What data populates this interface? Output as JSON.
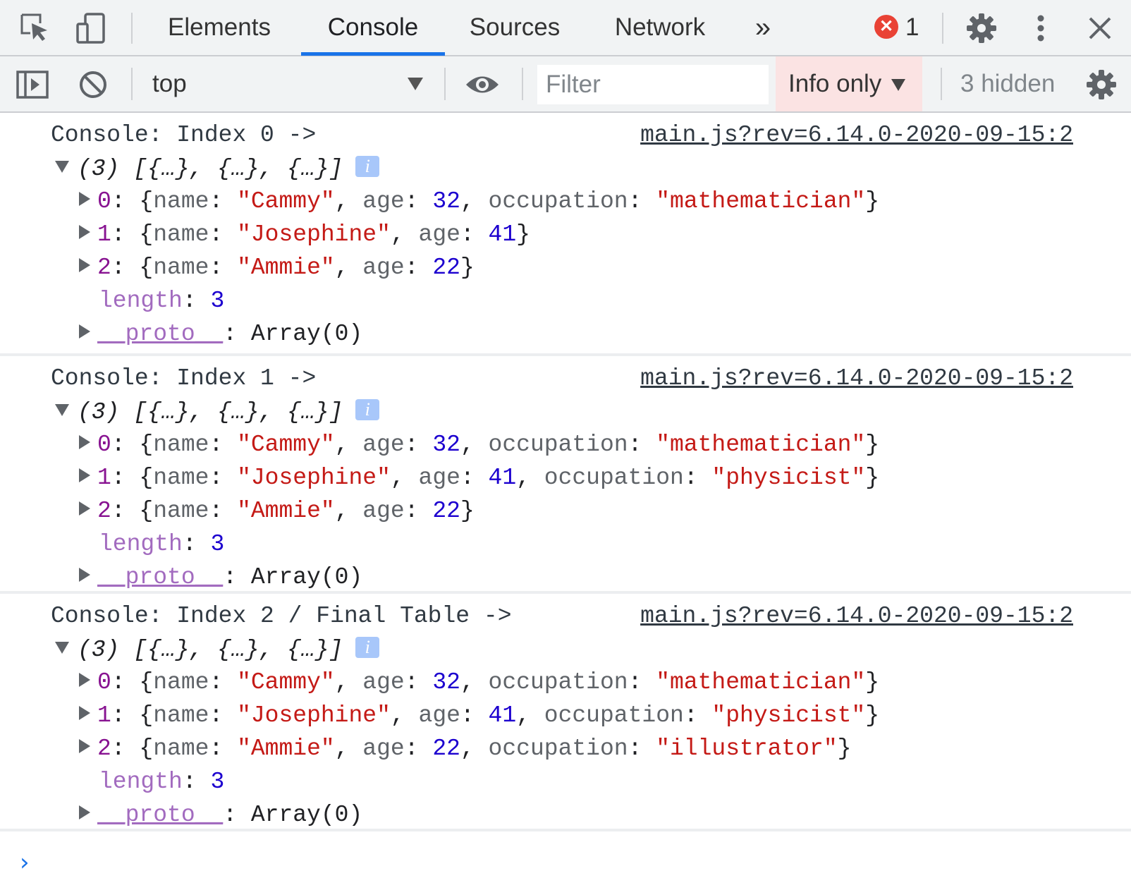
{
  "tabbar": {
    "tabs": [
      "Elements",
      "Console",
      "Sources",
      "Network"
    ],
    "overflow": "»",
    "error_count": "1",
    "error_badge": "✕"
  },
  "toolbar": {
    "context": "top",
    "filter_placeholder": "Filter",
    "levels_label": "Info only",
    "hidden_count": "3 hidden"
  },
  "messages": [
    {
      "header": "Console: Index 0 ->",
      "source": "main.js?rev=6.14.0-2020-09-15:2",
      "summary": "(3) [{…}, {…}, {…}]",
      "info_badge": "i",
      "rows": [
        {
          "index": "0",
          "name": "\"Cammy\"",
          "age": "32",
          "occupation": "\"mathematician\""
        },
        {
          "index": "1",
          "name": "\"Josephine\"",
          "age": "41",
          "occupation": ""
        },
        {
          "index": "2",
          "name": "\"Ammie\"",
          "age": "22",
          "occupation": ""
        }
      ],
      "length_key": "length",
      "length_value": "3",
      "proto_key": "__proto__",
      "proto_value": "Array(0)"
    },
    {
      "header": "Console: Index 1 ->",
      "source": "main.js?rev=6.14.0-2020-09-15:2",
      "summary": "(3) [{…}, {…}, {…}]",
      "info_badge": "i",
      "rows": [
        {
          "index": "0",
          "name": "\"Cammy\"",
          "age": "32",
          "occupation": "\"mathematician\""
        },
        {
          "index": "1",
          "name": "\"Josephine\"",
          "age": "41",
          "occupation": "\"physicist\""
        },
        {
          "index": "2",
          "name": "\"Ammie\"",
          "age": "22",
          "occupation": ""
        }
      ],
      "length_key": "length",
      "length_value": "3",
      "proto_key": "__proto__",
      "proto_value": "Array(0)"
    },
    {
      "header": "Console: Index 2 / Final Table ->",
      "source": "main.js?rev=6.14.0-2020-09-15:2",
      "summary": "(3) [{…}, {…}, {…}]",
      "info_badge": "i",
      "rows": [
        {
          "index": "0",
          "name": "\"Cammy\"",
          "age": "32",
          "occupation": "\"mathematician\""
        },
        {
          "index": "1",
          "name": "\"Josephine\"",
          "age": "41",
          "occupation": "\"physicist\""
        },
        {
          "index": "2",
          "name": "\"Ammie\"",
          "age": "22",
          "occupation": "\"illustrator\""
        }
      ],
      "length_key": "length",
      "length_value": "3",
      "proto_key": "__proto__",
      "proto_value": "Array(0)"
    }
  ],
  "prompt": {
    "chevron": "›"
  },
  "colors": {
    "accent": "#1a73e8",
    "error": "#e94235",
    "string": "#c41a16",
    "number": "#1c00cf",
    "index_key": "#881391",
    "meta_key": "#a26bbf",
    "levels_bg": "#fbe3e3"
  }
}
